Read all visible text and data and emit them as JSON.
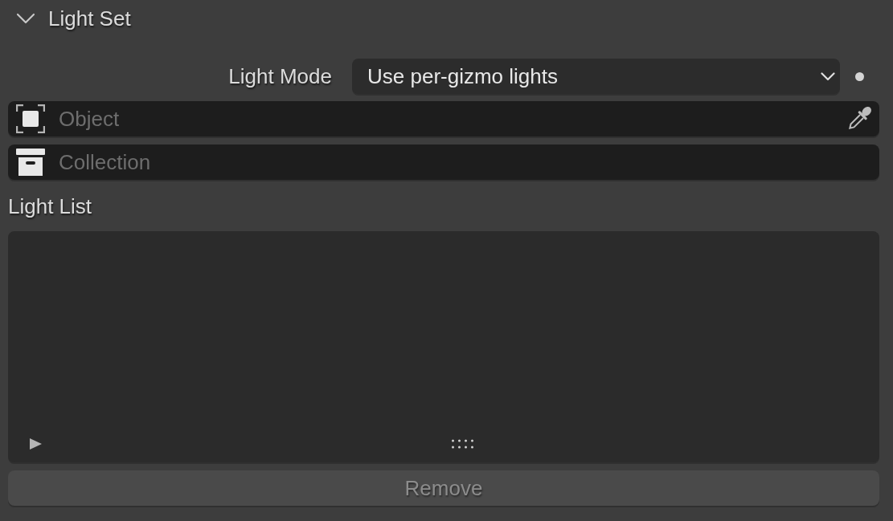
{
  "panel": {
    "title": "Light Set",
    "expanded": true
  },
  "light_mode": {
    "label": "Light Mode",
    "value": "Use per-gizmo lights"
  },
  "object_field": {
    "placeholder": "Object"
  },
  "collection_field": {
    "placeholder": "Collection"
  },
  "light_list": {
    "label": "Light List"
  },
  "remove_button": {
    "label": "Remove",
    "disabled": true
  }
}
